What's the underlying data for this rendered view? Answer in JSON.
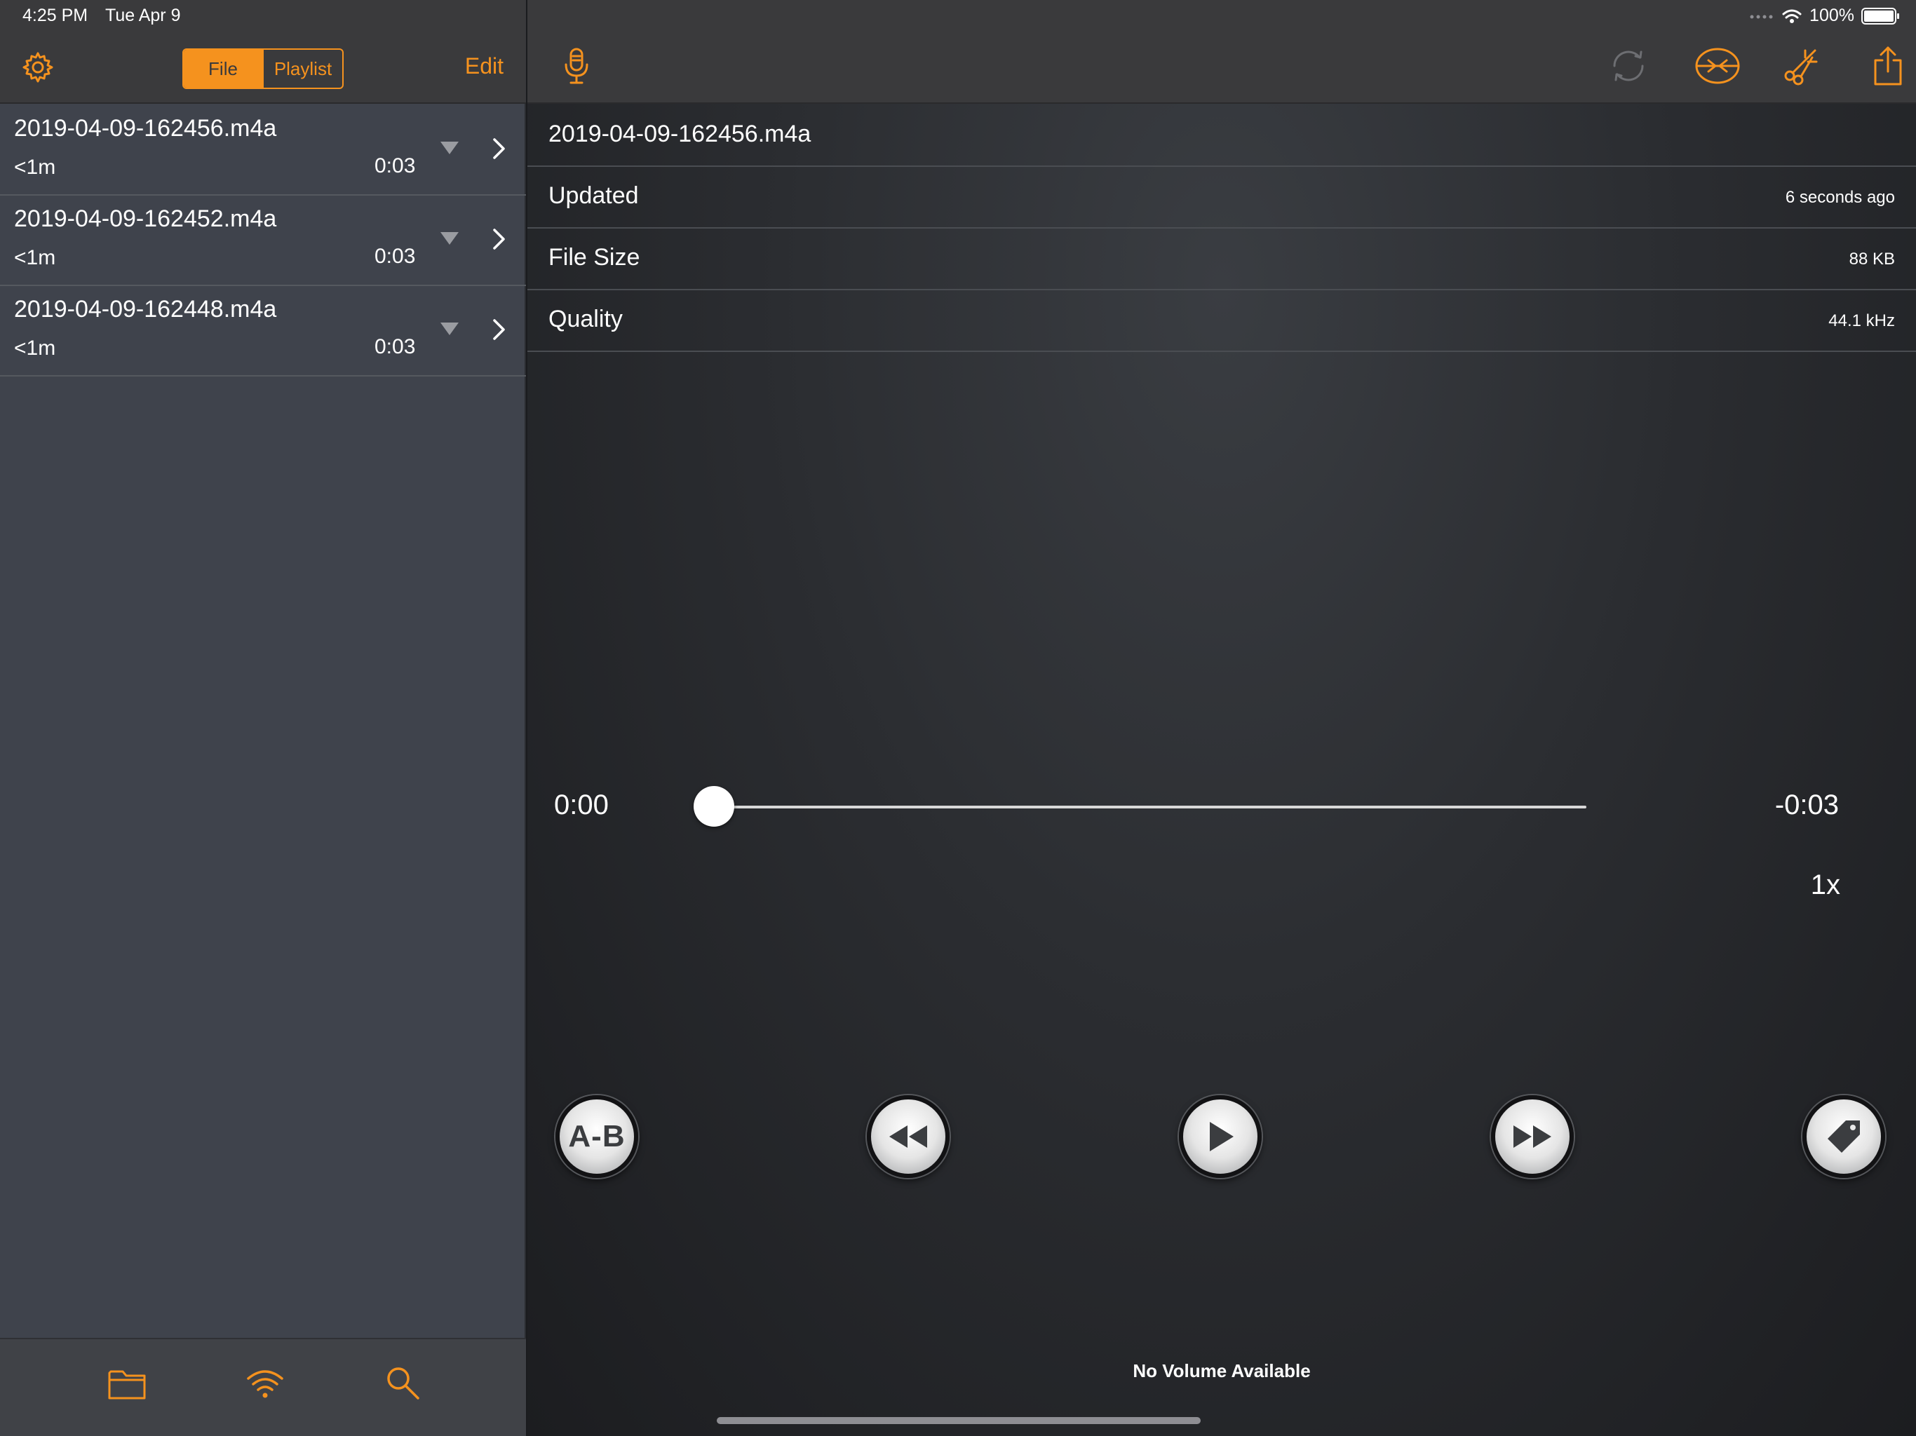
{
  "status_bar": {
    "time": "4:25 PM",
    "date": "Tue Apr 9",
    "battery": "100%",
    "battery_level": 1.0
  },
  "left_header": {
    "segments": {
      "file": "File",
      "playlist": "Playlist",
      "selected": "File"
    },
    "edit_label": "Edit",
    "settings_icon": "gear-icon"
  },
  "files": [
    {
      "name": "2019-04-09-162456.m4a",
      "age": "<1m",
      "duration": "0:03"
    },
    {
      "name": "2019-04-09-162452.m4a",
      "age": "<1m",
      "duration": "0:03"
    },
    {
      "name": "2019-04-09-162448.m4a",
      "age": "<1m",
      "duration": "0:03"
    }
  ],
  "left_toolbar": {
    "icons": [
      "folder-icon",
      "wifi-icon",
      "search-icon"
    ]
  },
  "right_header": {
    "icons": [
      "microphone-icon",
      "sync-icon",
      "convert-icon",
      "scissors-icon",
      "share-icon"
    ]
  },
  "details": {
    "filename": "2019-04-09-162456.m4a",
    "rows": [
      {
        "label": "Updated",
        "value": "6 seconds ago"
      },
      {
        "label": "File Size",
        "value": "88 KB"
      },
      {
        "label": "Quality",
        "value": "44.1 kHz"
      }
    ]
  },
  "player": {
    "current_time": "0:00",
    "remaining_time": "-0:03",
    "progress": 0.0,
    "speed": "1x",
    "ab_label": "A-B",
    "volume_text": "No Volume Available"
  },
  "colors": {
    "accent": "#f5921e",
    "left_panel": "#3f434c",
    "header": "#3a3a3c"
  }
}
